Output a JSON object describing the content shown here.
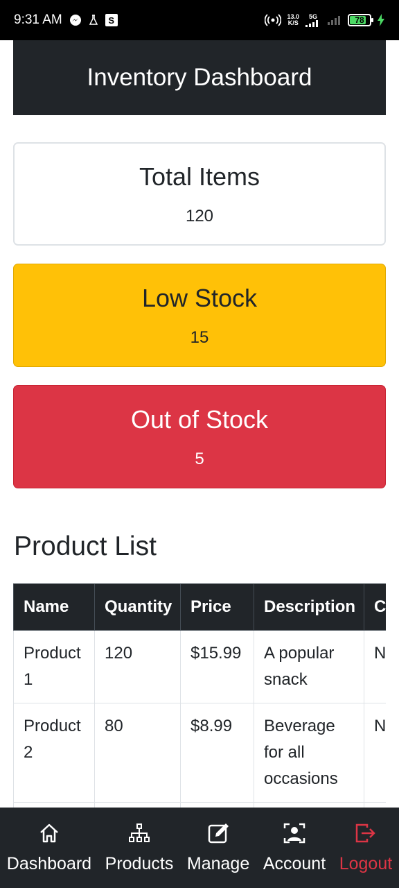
{
  "status_bar": {
    "time": "9:31 AM",
    "net_speed_value": "13.0",
    "net_speed_unit": "K/S",
    "network_type": "5G",
    "battery_level": "78"
  },
  "header": {
    "title": "Inventory Dashboard"
  },
  "cards": {
    "total": {
      "title": "Total Items",
      "value": "120"
    },
    "low": {
      "title": "Low Stock",
      "value": "15"
    },
    "out": {
      "title": "Out of Stock",
      "value": "5"
    }
  },
  "product_list": {
    "title": "Product List",
    "columns": [
      "Name",
      "Quantity",
      "Price",
      "Description",
      "C"
    ],
    "rows": [
      {
        "name": "Product 1",
        "quantity": "120",
        "price": "$15.99",
        "description": "A popular snack",
        "c": "N"
      },
      {
        "name": "Product 2",
        "quantity": "80",
        "price": "$8.99",
        "description": "Beverage for all occasions",
        "c": "N"
      }
    ]
  },
  "bottom_nav": {
    "items": [
      {
        "label": "Dashboard",
        "icon": "home-icon"
      },
      {
        "label": "Products",
        "icon": "sitemap-icon"
      },
      {
        "label": "Manage",
        "icon": "edit-icon"
      },
      {
        "label": "Account",
        "icon": "account-icon"
      },
      {
        "label": "Logout",
        "icon": "logout-icon"
      }
    ],
    "logout_color": "#dc3545"
  },
  "colors": {
    "header_bg": "#212529",
    "low_stock": "#ffc107",
    "out_of_stock": "#dc3545"
  }
}
